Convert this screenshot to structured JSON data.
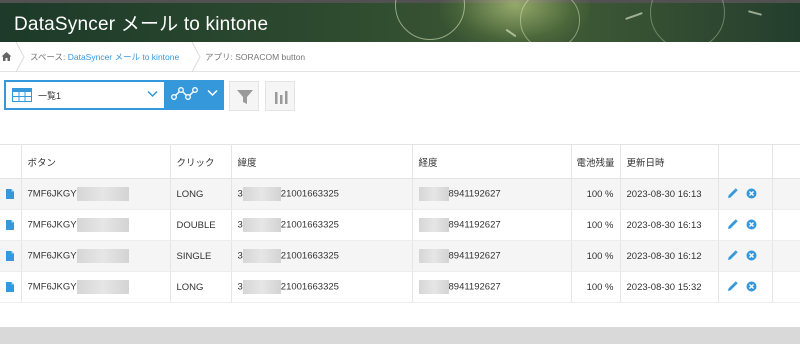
{
  "app": {
    "title": "DataSyncer メール to kintone"
  },
  "breadcrumb": {
    "home_icon": "home-icon",
    "space_prefix": "スペース: ",
    "space_name": "DataSyncer メール to kintone",
    "app_prefix": "アプリ: ",
    "app_name": "SORACOM button"
  },
  "toolbar": {
    "view_icon": "grid-table-icon",
    "view_selected": "一覧1",
    "graph_icon": "line-graph-icon",
    "filter_icon": "filter-funnel-icon",
    "chart_icon": "bar-chart-icon"
  },
  "table": {
    "headers": {
      "button": "ボタン",
      "click": "クリック",
      "latitude": "緯度",
      "longitude": "経度",
      "battery": "電池残量",
      "updated": "更新日時"
    },
    "rows": [
      {
        "button": "7MF6JKGY",
        "click": "LONG",
        "latitude_prefix": "3",
        "latitude": "21001663325",
        "longitude": "8941192627",
        "battery": "100 %",
        "updated": "2023-08-30 16:13"
      },
      {
        "button": "7MF6JKGY",
        "click": "DOUBLE",
        "latitude_prefix": "3",
        "latitude": "21001663325",
        "longitude": "8941192627",
        "battery": "100 %",
        "updated": "2023-08-30 16:13"
      },
      {
        "button": "7MF6JKGY",
        "click": "SINGLE",
        "latitude_prefix": "3",
        "latitude": "21001663325",
        "longitude": "8941192627",
        "battery": "100 %",
        "updated": "2023-08-30 16:12"
      },
      {
        "button": "7MF6JKGY",
        "click": "LONG",
        "latitude_prefix": "3",
        "latitude": "21001663325",
        "longitude": "8941192627",
        "battery": "100 %",
        "updated": "2023-08-30 15:32"
      }
    ]
  },
  "colors": {
    "accent": "#3498db",
    "row_alt": "#f5f5f5"
  }
}
